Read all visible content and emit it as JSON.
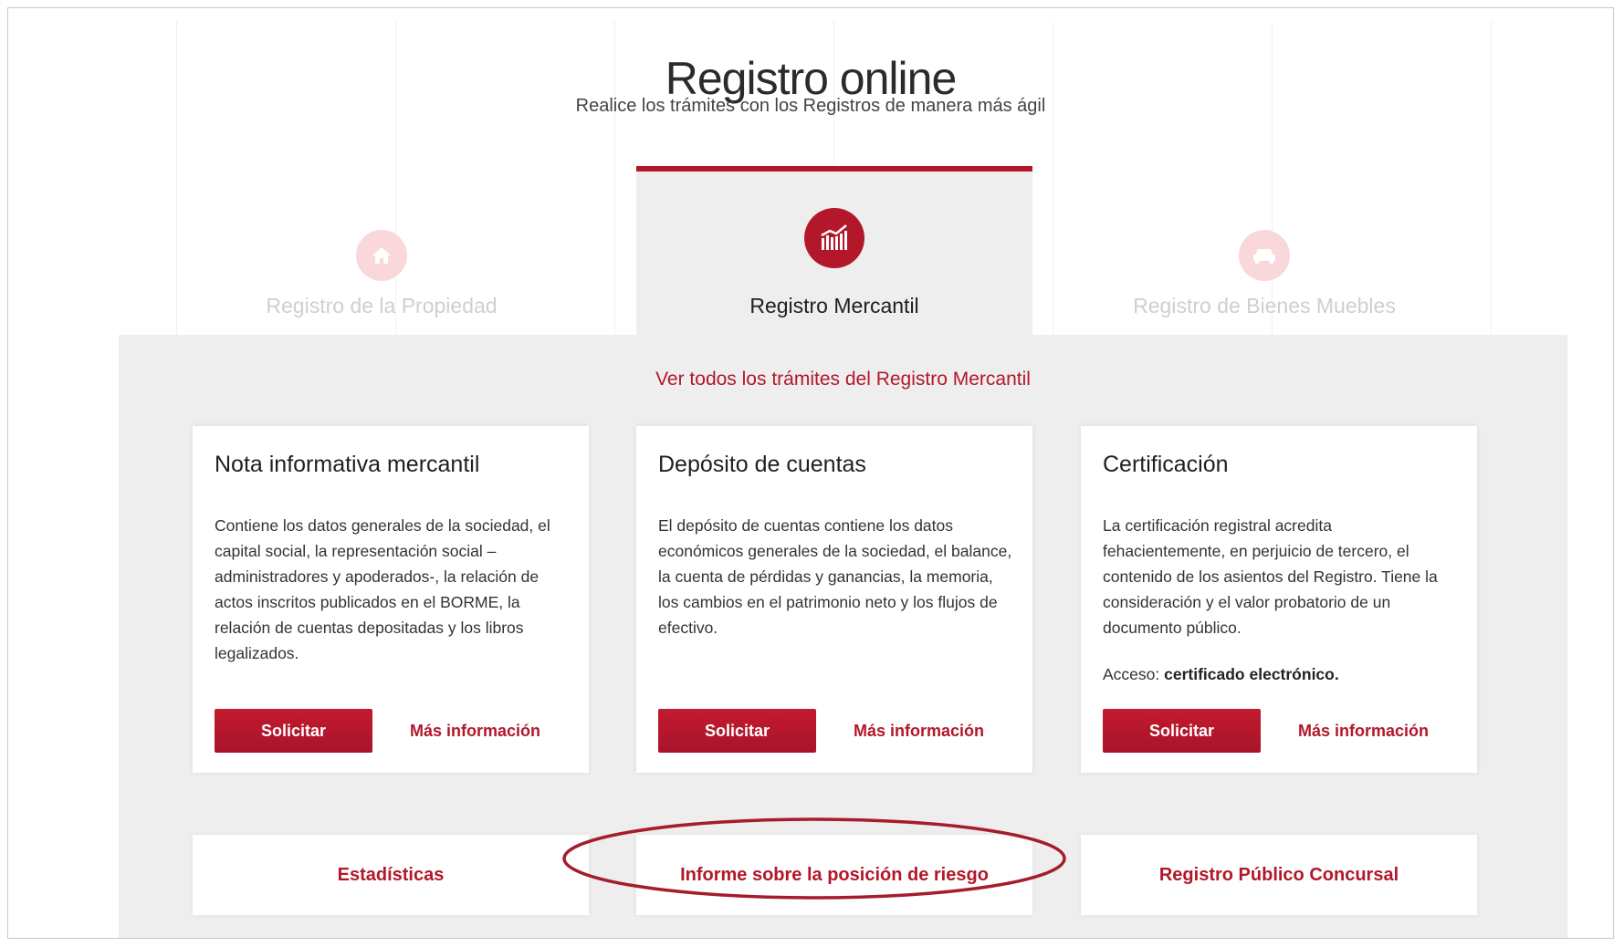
{
  "header": {
    "title": "Registro online",
    "subtitle": "Realice los trámites con los Registros de manera más ágil"
  },
  "tabs": [
    {
      "label": "Registro de la Propiedad",
      "icon": "house-icon",
      "active": false
    },
    {
      "label": "Registro Mercantil",
      "icon": "chart-icon",
      "active": true
    },
    {
      "label": "Registro de Bienes Muebles",
      "icon": "car-icon",
      "active": false
    }
  ],
  "panel": {
    "link": "Ver todos los trámites del Registro Mercantil",
    "cards": [
      {
        "title": "Nota informativa mercantil",
        "description": "Contiene los datos generales de la sociedad, el capital social, la representación social –administradores y apoderados-, la relación de actos inscritos publicados en el BORME, la relación de cuentas depositadas y los libros legalizados.",
        "button": "Solicitar",
        "more": "Más información"
      },
      {
        "title": "Depósito de cuentas",
        "description": "El depósito de cuentas contiene los datos económicos generales de la sociedad, el balance, la cuenta de pérdidas y ganancias, la memoria, los cambios en el patrimonio neto y los flujos de efectivo.",
        "button": "Solicitar",
        "more": "Más información"
      },
      {
        "title": "Certificación",
        "description": "La certificación registral acredita fehacientemente, en perjuicio de tercero, el contenido de los asientos del Registro. Tiene la consideración y el valor probatorio de un documento público.",
        "access_label": "Acceso:",
        "access_value": "certificado electrónico.",
        "button": "Solicitar",
        "more": "Más información"
      }
    ],
    "bottom_links": [
      "Estadísticas",
      "Informe sobre la posición de riesgo",
      "Registro Público Concursal"
    ]
  },
  "colors": {
    "accent": "#b3172a",
    "panel_bg": "#eeeeee",
    "highlight_ellipse": "#a51d2d"
  }
}
